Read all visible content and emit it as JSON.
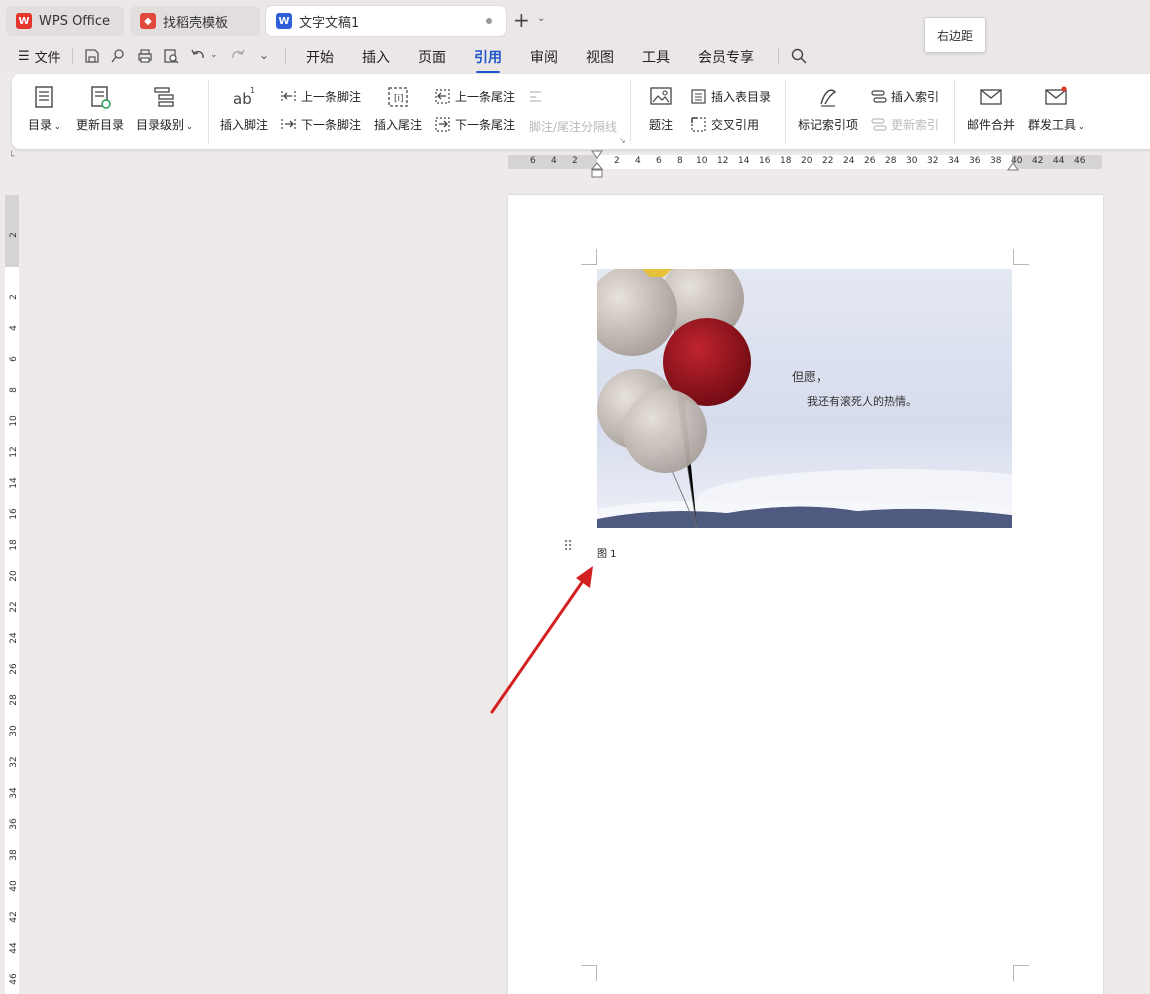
{
  "titlebar": {
    "tabs": [
      {
        "label": "WPS Office",
        "icon": "wps-logo-icon",
        "color": "#e5342a"
      },
      {
        "label": "找稻壳模板",
        "icon": "docer-logo-icon",
        "color": "#e2493d"
      },
      {
        "label": "文字文稿1",
        "icon": "word-doc-icon",
        "color": "#2e5fd8"
      }
    ],
    "new_tab_label": "+"
  },
  "menubar": {
    "file_label": "文件",
    "tabs": [
      "开始",
      "插入",
      "页面",
      "引用",
      "审阅",
      "视图",
      "工具",
      "会员专享"
    ],
    "active_tab": "引用",
    "accent_color": "#1f56c9"
  },
  "tooltip": {
    "text": "右边距"
  },
  "ribbon": {
    "toc": "目录",
    "update_toc": "更新目录",
    "toc_level": "目录级别",
    "insert_footnote": "插入脚注",
    "prev_footnote": "上一条脚注",
    "next_footnote": "下一条脚注",
    "insert_endnote": "插入尾注",
    "prev_endnote": "上一条尾注",
    "next_endnote": "下一条尾注",
    "separator": "脚注/尾注分隔线",
    "caption": "题注",
    "insert_table_of_figures": "插入表目录",
    "cross_reference": "交叉引用",
    "mark_index": "标记索引项",
    "insert_index": "插入索引",
    "update_index": "更新索引",
    "mail_merge": "邮件合并",
    "bulk_send": "群发工具"
  },
  "hruler": {
    "left_ticks": [
      "6",
      "4",
      "2"
    ],
    "ticks": [
      "2",
      "4",
      "6",
      "8",
      "10",
      "12",
      "14",
      "16",
      "18",
      "20",
      "22",
      "24",
      "26",
      "28",
      "30",
      "32",
      "34",
      "36",
      "38",
      "40",
      "42",
      "44",
      "46"
    ]
  },
  "vruler": {
    "top_tick": "2",
    "ticks": [
      "2",
      "4",
      "6",
      "8",
      "10",
      "12",
      "14",
      "16",
      "18",
      "20",
      "22",
      "24",
      "26",
      "28",
      "30",
      "32",
      "34",
      "36",
      "38",
      "40",
      "42",
      "44",
      "46"
    ]
  },
  "document": {
    "image": {
      "line1": "但愿，",
      "line2": "我还有滚死人的热情。"
    },
    "caption": "图 1"
  },
  "annotation": {
    "arrow_color": "#d42020"
  }
}
